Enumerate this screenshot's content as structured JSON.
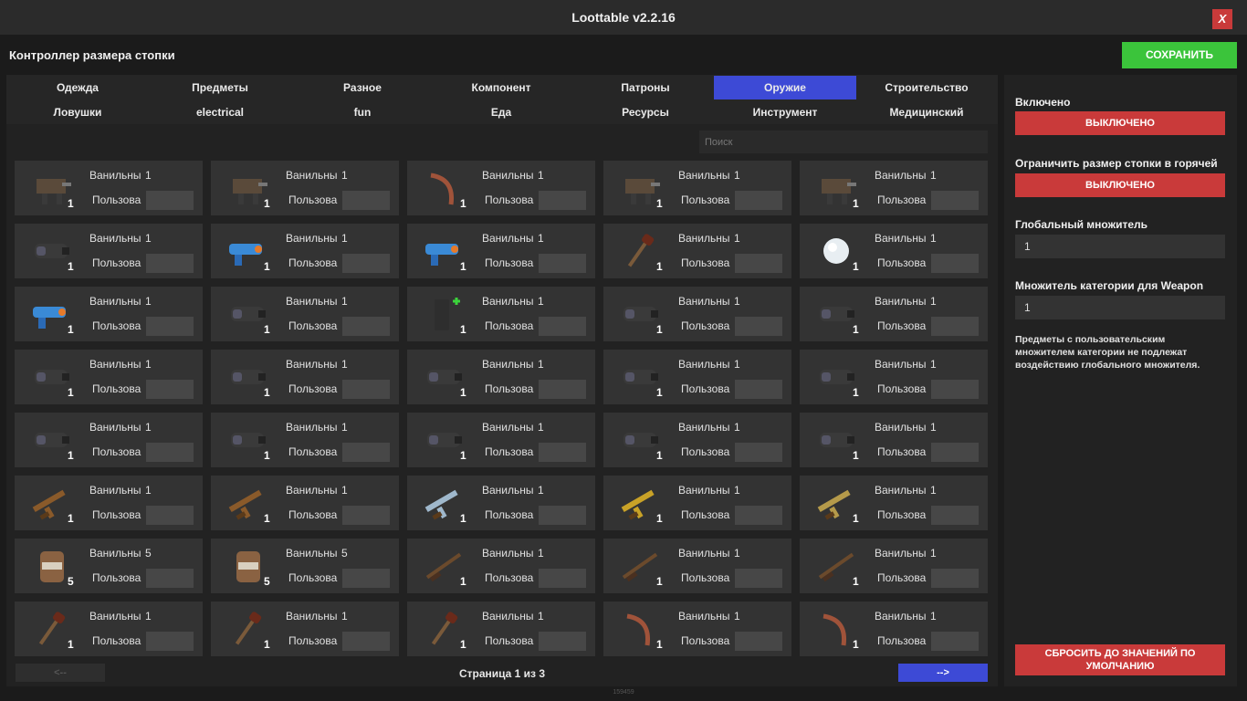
{
  "window": {
    "title": "Loottable v2.2.16",
    "close_label": "X"
  },
  "header": {
    "title": "Контроллер размера стопки",
    "save_label": "СОХРАНИТЬ"
  },
  "tabs": [
    {
      "label": "Одежда",
      "active": false
    },
    {
      "label": "Предметы",
      "active": false
    },
    {
      "label": "Разное",
      "active": false
    },
    {
      "label": "Компонент",
      "active": false
    },
    {
      "label": "Патроны",
      "active": false
    },
    {
      "label": "Оружие",
      "active": true
    },
    {
      "label": "Строительство",
      "active": false
    },
    {
      "label": "Ловушки",
      "active": false
    },
    {
      "label": "electrical",
      "active": false
    },
    {
      "label": "fun",
      "active": false
    },
    {
      "label": "Еда",
      "active": false
    },
    {
      "label": "Ресурсы",
      "active": false
    },
    {
      "label": "Инструмент",
      "active": false
    },
    {
      "label": "Медицинский",
      "active": false
    }
  ],
  "search": {
    "placeholder": "Поиск"
  },
  "card_labels": {
    "vanilla": "Ванильны",
    "custom": "Пользова"
  },
  "items": [
    {
      "icon": "auto-turret-icon",
      "vanilla": "1",
      "qty": "1"
    },
    {
      "icon": "sentry-turret-icon",
      "vanilla": "1",
      "qty": "1"
    },
    {
      "icon": "crossbow-icon",
      "vanilla": "1",
      "qty": "1"
    },
    {
      "icon": "ballista-icon",
      "vanilla": "1",
      "qty": "1"
    },
    {
      "icon": "tesla-coil-icon",
      "vanilla": "1",
      "qty": "1"
    },
    {
      "icon": "chainsaw-blade-icon",
      "vanilla": "1",
      "qty": "1"
    },
    {
      "icon": "toy-blaster-icon",
      "vanilla": "1",
      "qty": "1"
    },
    {
      "icon": "water-gun-icon",
      "vanilla": "1",
      "qty": "1"
    },
    {
      "icon": "candy-cane-club-icon",
      "vanilla": "1",
      "qty": "1"
    },
    {
      "icon": "snowball-icon",
      "vanilla": "1",
      "qty": "1"
    },
    {
      "icon": "snowball-gun-icon",
      "vanilla": "1",
      "qty": "1"
    },
    {
      "icon": "scope-icon",
      "vanilla": "1",
      "qty": "1"
    },
    {
      "icon": "extended-magazine-icon",
      "vanilla": "1",
      "qty": "1"
    },
    {
      "icon": "flashlight-attachment-icon",
      "vanilla": "1",
      "qty": "1"
    },
    {
      "icon": "rocket-launcher-icon",
      "vanilla": "1",
      "qty": "1"
    },
    {
      "icon": "gun-box-icon",
      "vanilla": "1",
      "qty": "1"
    },
    {
      "icon": "holosight-icon",
      "vanilla": "1",
      "qty": "1"
    },
    {
      "icon": "laser-sight-icon",
      "vanilla": "1",
      "qty": "1"
    },
    {
      "icon": "muzzle-brake-icon",
      "vanilla": "1",
      "qty": "1"
    },
    {
      "icon": "muzzle-boost-icon",
      "vanilla": "1",
      "qty": "1"
    },
    {
      "icon": "weapon-flashlight-icon",
      "vanilla": "1",
      "qty": "1"
    },
    {
      "icon": "silencer-icon",
      "vanilla": "1",
      "qty": "1"
    },
    {
      "icon": "oil-filter-silencer-icon",
      "vanilla": "1",
      "qty": "1"
    },
    {
      "icon": "small-scope-icon",
      "vanilla": "1",
      "qty": "1"
    },
    {
      "icon": "simple-sight-icon",
      "vanilla": "1",
      "qty": "1"
    },
    {
      "icon": "assault-rifle-icon",
      "vanilla": "1",
      "qty": "1"
    },
    {
      "icon": "assault-rifle-skin-icon",
      "vanilla": "1",
      "qty": "1"
    },
    {
      "icon": "ice-assault-rifle-icon",
      "vanilla": "1",
      "qty": "1"
    },
    {
      "icon": "gold-assault-rifle-icon",
      "vanilla": "1",
      "qty": "1"
    },
    {
      "icon": "camo-assault-rifle-icon",
      "vanilla": "1",
      "qty": "1"
    },
    {
      "icon": "ammo-barrel-icon",
      "vanilla": "5",
      "qty": "5"
    },
    {
      "icon": "jar-icon",
      "vanilla": "5",
      "qty": "5"
    },
    {
      "icon": "bolt-rifle-icon",
      "vanilla": "1",
      "qty": "1"
    },
    {
      "icon": "hunting-rifle-icon",
      "vanilla": "1",
      "qty": "1"
    },
    {
      "icon": "double-barrel-icon",
      "vanilla": "1",
      "qty": "1"
    },
    {
      "icon": "torch-icon",
      "vanilla": "1",
      "qty": "1"
    },
    {
      "icon": "hammer-icon",
      "vanilla": "1",
      "qty": "1"
    },
    {
      "icon": "spiked-club-icon",
      "vanilla": "1",
      "qty": "1"
    },
    {
      "icon": "boomerang-icon",
      "vanilla": "1",
      "qty": "1"
    },
    {
      "icon": "bow-icon",
      "vanilla": "1",
      "qty": "1"
    }
  ],
  "pager": {
    "prev_label": "<--",
    "next_label": "-->",
    "text": "Страница 1 из 3"
  },
  "side": {
    "enabled_label": "Включено",
    "enabled_value": "ВЫКЛЮЧЕНО",
    "limit_label": "Ограничить размер стопки в горячей",
    "limit_value": "ВЫКЛЮЧЕНО",
    "global_label": "Глобальный множитель",
    "global_value": "1",
    "category_label": "Множитель категории для Weapon",
    "category_value": "1",
    "note": "Предметы с пользовательским множителем категории не подлежат воздействию глобального множителя.",
    "reset_label": "СБРОСИТЬ ДО ЗНАЧЕНИЙ ПО УМОЛЧАНИЮ"
  },
  "footer": {
    "id": "159459"
  },
  "colors": {
    "accent": "#3d4ad6",
    "save": "#3bc43b",
    "danger": "#c93a3a"
  }
}
